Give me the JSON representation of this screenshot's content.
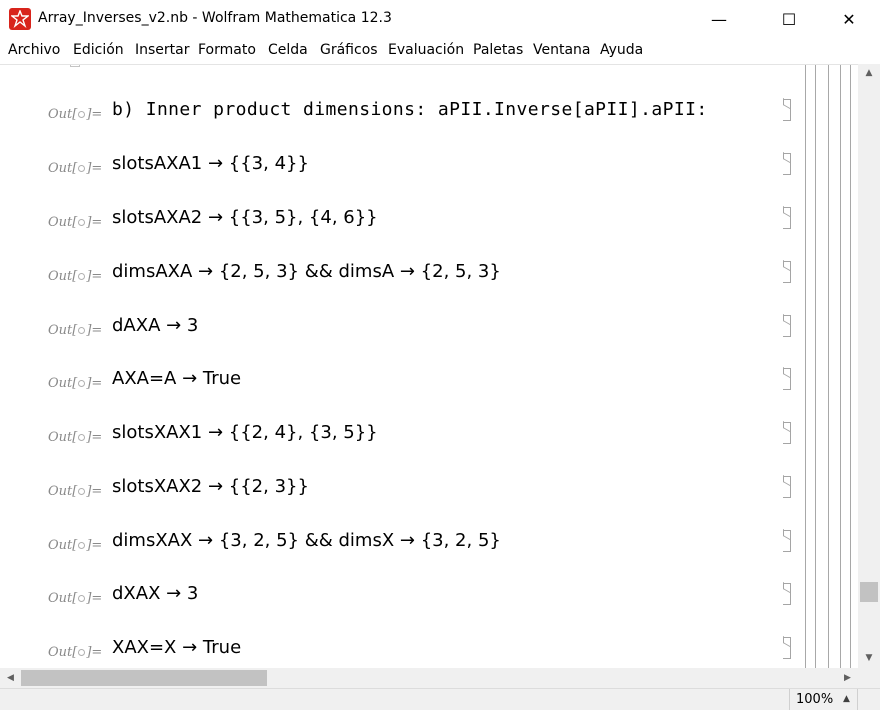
{
  "window": {
    "title": "Array_Inverses_v2.nb - Wolfram Mathematica 12.3",
    "minimize": "—",
    "maximize": "☐",
    "close": "✕"
  },
  "menu": {
    "items": [
      "Archivo",
      "Edición",
      "Insertar",
      "Formato",
      "Celda",
      "Gráficos",
      "Evaluación",
      "Paletas",
      "Ventana",
      "Ayuda"
    ]
  },
  "notebook": {
    "out_prefix": "Out[",
    "out_suffix": "]=",
    "cells": [
      {
        "text": "b) Inner product dimensions: aPII.Inverse[aPII].aPII:"
      },
      {
        "text": "slotsAXA1 → {{3, 4}}"
      },
      {
        "text": "slotsAXA2 → {{3, 5}, {4, 6}}"
      },
      {
        "text": "dimsAXA → {2, 5, 3} && dimsA → {2, 5, 3}"
      },
      {
        "text": "dAXA → 3"
      },
      {
        "text": "AXA=A → True"
      },
      {
        "text": "slotsXAX1 → {{2, 4}, {3, 5}}"
      },
      {
        "text": "slotsXAX2 → {{2, 3}}"
      },
      {
        "text": "dimsXAX → {3, 2, 5} && dimsX → {3, 2, 5}"
      },
      {
        "text": "dXAX → 3"
      },
      {
        "text": "XAX=X → True"
      }
    ]
  },
  "scrollbars": {
    "up_arrow": "▲",
    "down_arrow": "▼",
    "left_arrow": "◀",
    "right_arrow": "▶"
  },
  "status": {
    "zoom": "100%",
    "zoom_arrow": "▲"
  },
  "colors": {
    "app_icon": "#d8241c",
    "out_label": "#8a8a8a",
    "cell_bracket": "#a5a5a5"
  }
}
